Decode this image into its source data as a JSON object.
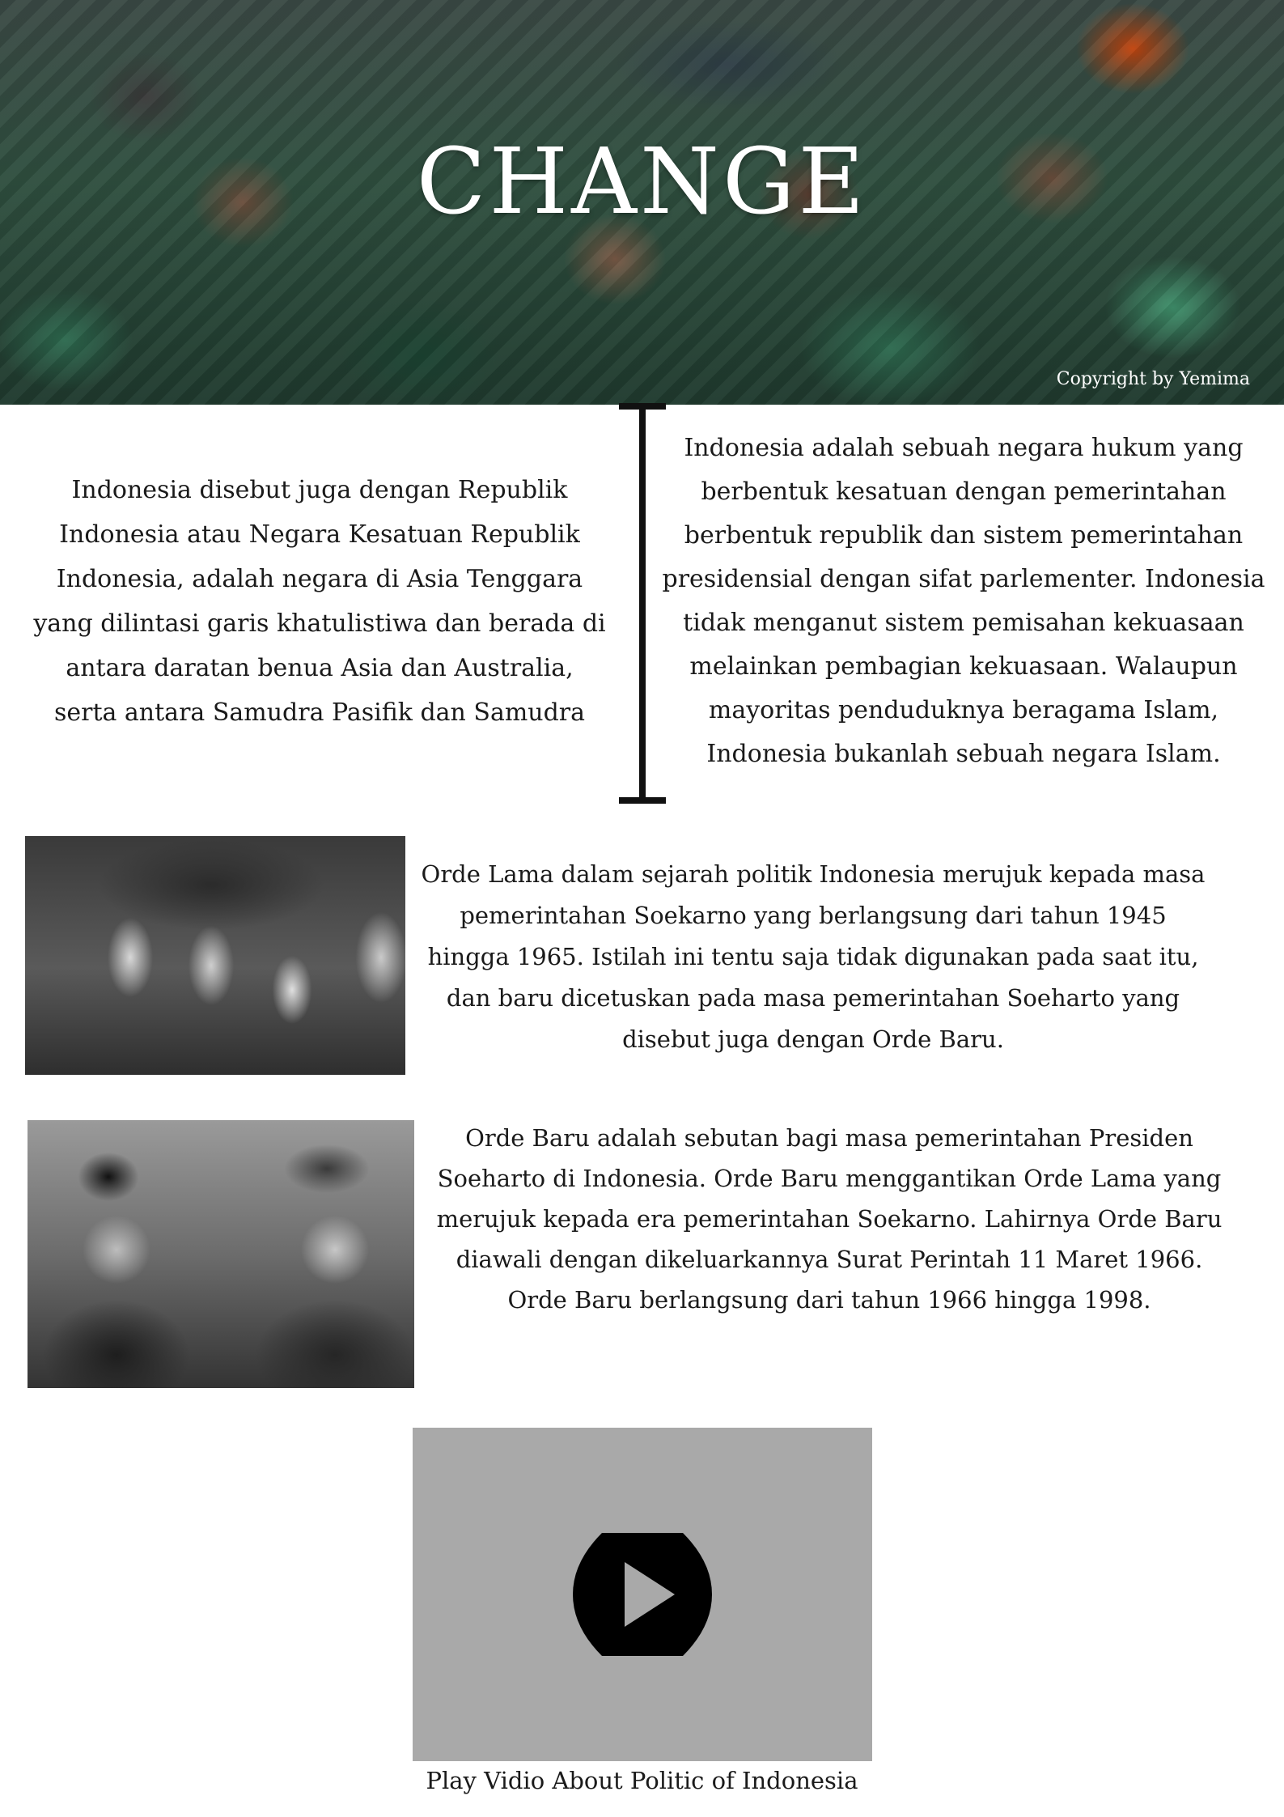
{
  "hero": {
    "title": "CHANGE",
    "copyright": "Copyright by Yemima"
  },
  "paragraphs": {
    "left": "Indonesia disebut juga dengan Republik Indonesia atau Negara Kesatuan Republik Indonesia, adalah negara di Asia Tenggara yang dilintasi garis khatulistiwa dan berada di antara daratan benua Asia dan Australia, serta antara Samudra Pasifik dan Samudra",
    "right": "Indonesia adalah sebuah negara hukum yang berbentuk kesatuan dengan pemerintahan berbentuk republik dan sistem pemerintahan presidensial dengan sifat parlementer. Indonesia tidak menganut sistem pemisahan kekuasaan melainkan pembagian kekuasaan. Walaupun mayoritas penduduknya beragama Islam, Indonesia bukanlah sebuah negara Islam.",
    "orde_lama": "Orde Lama dalam sejarah politik Indonesia merujuk kepada masa pemerintahan Soekarno yang berlangsung dari tahun 1945 hingga 1965. Istilah ini tentu saja tidak digunakan pada saat itu, dan baru dicetuskan pada masa pemerintahan Soeharto yang disebut juga dengan Orde Baru.",
    "orde_baru": "Orde Baru adalah sebutan bagi masa pemerintahan Presiden Soeharto di Indonesia. Orde Baru menggantikan Orde Lama yang merujuk kepada era pemerintahan Soekarno. Lahirnya Orde Baru diawali dengan dikeluarkannya Surat Perintah 11 Maret 1966. Orde Baru berlangsung dari tahun 1966 hingga 1998."
  },
  "video": {
    "caption": "Play Vidio About Politic of Indonesia",
    "play_icon": "play-icon"
  },
  "colors": {
    "text": "#1a1a1a",
    "video_bg": "#a9a9a9",
    "hero_green": "#2d6a4f"
  }
}
